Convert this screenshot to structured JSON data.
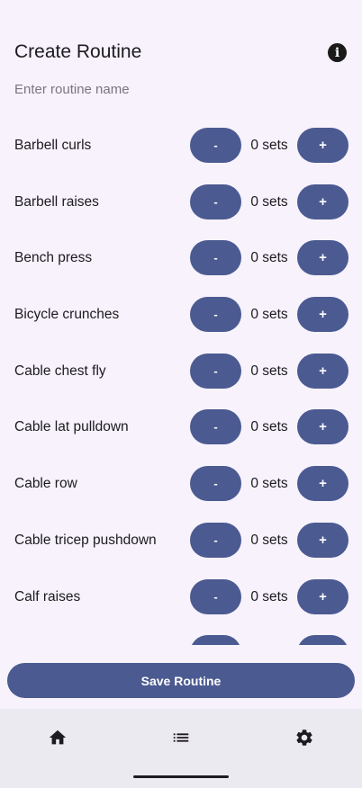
{
  "header": {
    "title": "Create Routine",
    "info_icon": "info-icon"
  },
  "name_input": {
    "placeholder": "Enter routine name",
    "value": ""
  },
  "exercises": [
    {
      "name": "Barbell curls",
      "minus_label": "-",
      "sets": "0 sets",
      "plus_label": "+"
    },
    {
      "name": "Barbell raises",
      "minus_label": "-",
      "sets": "0 sets",
      "plus_label": "+"
    },
    {
      "name": "Bench press",
      "minus_label": "-",
      "sets": "0 sets",
      "plus_label": "+"
    },
    {
      "name": "Bicycle crunches",
      "minus_label": "-",
      "sets": "0 sets",
      "plus_label": "+"
    },
    {
      "name": "Cable chest fly",
      "minus_label": "-",
      "sets": "0 sets",
      "plus_label": "+"
    },
    {
      "name": "Cable lat pulldown",
      "minus_label": "-",
      "sets": "0 sets",
      "plus_label": "+"
    },
    {
      "name": "Cable row",
      "minus_label": "-",
      "sets": "0 sets",
      "plus_label": "+"
    },
    {
      "name": "Cable tricep pushdown",
      "minus_label": "-",
      "sets": "0 sets",
      "plus_label": "+"
    },
    {
      "name": "Calf raises",
      "minus_label": "-",
      "sets": "0 sets",
      "plus_label": "+"
    },
    {
      "name": "",
      "minus_label": "",
      "sets": "",
      "plus_label": ""
    }
  ],
  "save_button": {
    "label": "Save Routine"
  },
  "bottom_nav": [
    {
      "icon": "home-icon"
    },
    {
      "icon": "list-icon"
    },
    {
      "icon": "gear-icon"
    }
  ],
  "colors": {
    "background": "#f7f2fb",
    "button": "#4b5a91",
    "nav_background": "#eceaf1",
    "text": "#1c1b1f",
    "placeholder": "#7a7680"
  }
}
